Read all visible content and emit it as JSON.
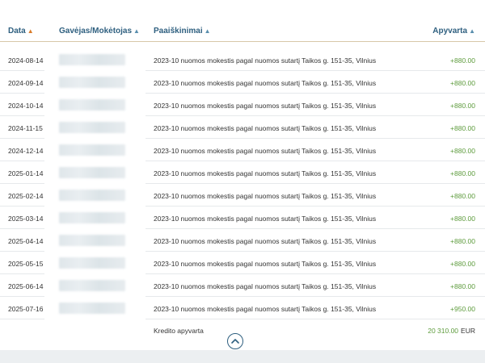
{
  "columns": {
    "date": "Data",
    "payer": "Gavėjas/Mokėtojas",
    "description": "Paaiškinimai",
    "amount": "Apyvarta"
  },
  "rows": [
    {
      "date": "2024-08-14",
      "description": "2023-10 nuomos mokestis pagal nuomos sutartį Taikos g. 151-35, Vilnius",
      "amount": "+880.00"
    },
    {
      "date": "2024-09-14",
      "description": "2023-10 nuomos mokestis pagal nuomos sutartį Taikos g. 151-35, Vilnius",
      "amount": "+880.00"
    },
    {
      "date": "2024-10-14",
      "description": "2023-10 nuomos mokestis pagal nuomos sutartį Taikos g. 151-35, Vilnius",
      "amount": "+880.00"
    },
    {
      "date": "2024-11-15",
      "description": "2023-10 nuomos mokestis pagal nuomos sutartį Taikos g. 151-35, Vilnius",
      "amount": "+880.00"
    },
    {
      "date": "2024-12-14",
      "description": "2023-10 nuomos mokestis pagal nuomos sutartį Taikos g. 151-35, Vilnius",
      "amount": "+880.00"
    },
    {
      "date": "2025-01-14",
      "description": "2023-10 nuomos mokestis pagal nuomos sutartį Taikos g. 151-35, Vilnius",
      "amount": "+880.00"
    },
    {
      "date": "2025-02-14",
      "description": "2023-10 nuomos mokestis pagal nuomos sutartį Taikos g. 151-35, Vilnius",
      "amount": "+880.00"
    },
    {
      "date": "2025-03-14",
      "description": "2023-10 nuomos mokestis pagal nuomos sutartį Taikos g. 151-35, Vilnius",
      "amount": "+880.00"
    },
    {
      "date": "2025-04-14",
      "description": "2023-10 nuomos mokestis pagal nuomos sutartį Taikos g. 151-35, Vilnius",
      "amount": "+880.00"
    },
    {
      "date": "2025-05-15",
      "description": "2023-10 nuomos mokestis pagal nuomos sutartį Taikos g. 151-35, Vilnius",
      "amount": "+880.00"
    },
    {
      "date": "2025-06-14",
      "description": "2023-10 nuomos mokestis pagal nuomos sutartį Taikos g. 151-35, Vilnius",
      "amount": "+880.00"
    },
    {
      "date": "2025-07-16",
      "description": "2023-10 nuomos mokestis pagal nuomos sutartį Taikos g. 151-35, Vilnius",
      "amount": "+950.00"
    }
  ],
  "footer": {
    "label": "Kredito apyvarta",
    "total": "20 310.00",
    "currency": "EUR"
  },
  "colors": {
    "header_text": "#2e5f7f",
    "sort_active": "#d97c2a",
    "credit_green": "#5d9b3c"
  },
  "icons": {
    "sort_active": "triangle-up-icon",
    "scroll_top": "chevron-up-icon"
  }
}
